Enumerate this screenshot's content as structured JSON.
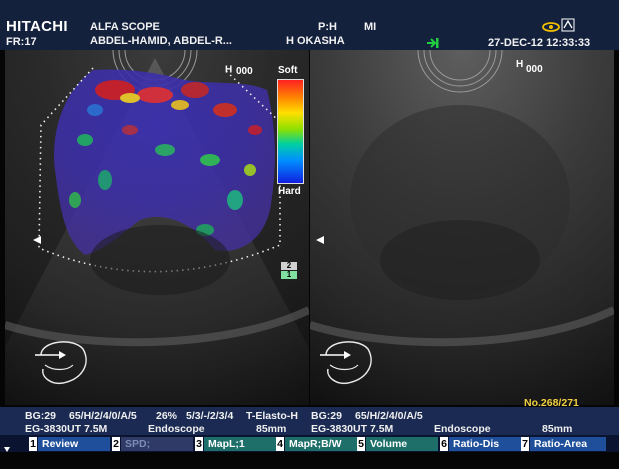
{
  "header": {
    "brand": "HITACHI",
    "frame_rate": "FR:17",
    "app_name": "ALFA SCOPE",
    "patient_name": "ABDEL-HAMID, ABDEL-R...",
    "ph": "P:H",
    "mi": "MI",
    "operator": "H OKASHA",
    "datetime": "27-DEC-12 12:33:33"
  },
  "left_pane": {
    "h_mark": "H",
    "h_sup": "000",
    "soft_label": "Soft",
    "hard_label": "Hard",
    "tag_2": "2",
    "tag_1": "1"
  },
  "right_pane": {
    "h_mark": "H",
    "h_sup": "000"
  },
  "frame_count": "No.268/271",
  "info_left": {
    "row1_bg": "BG:29",
    "row1_params": "65/H/2/4/0/A/5",
    "row1_pct": "26%",
    "row1_elasto": "5/3/-/2/3/4",
    "row1_mode": "T-Elasto-H",
    "row2_probe": "EG-3830UT 7.5M",
    "row2_type": "Endoscope",
    "row2_depth": "85mm"
  },
  "info_right": {
    "row1_bg": "BG:29",
    "row1_params": "65/H/2/4/0/A/5",
    "row2_probe": "EG-3830UT 7.5M",
    "row2_type": "Endoscope",
    "row2_depth": "85mm"
  },
  "softkeys": [
    {
      "num": "1",
      "label": "Review"
    },
    {
      "num": "2",
      "label": "SPD;"
    },
    {
      "num": "3",
      "label": "MapL;1"
    },
    {
      "num": "4",
      "label": "MapR;B/W"
    },
    {
      "num": "5",
      "label": "Volume"
    },
    {
      "num": "6",
      "label": "Ratio-Dis"
    },
    {
      "num": "7",
      "label": "Ratio-Area"
    }
  ],
  "colors": {
    "header_bg": "#14213d",
    "info_bg": "#1a2a52",
    "softkey_blue": "#1f4f9a",
    "softkey_teal": "#1e6f6a",
    "frame_count": "#f0d040"
  },
  "icons": [
    "eye-icon",
    "cine-exit-icon",
    "freeze-icon",
    "probe-orientation-icon",
    "triangle-marker-icon"
  ]
}
